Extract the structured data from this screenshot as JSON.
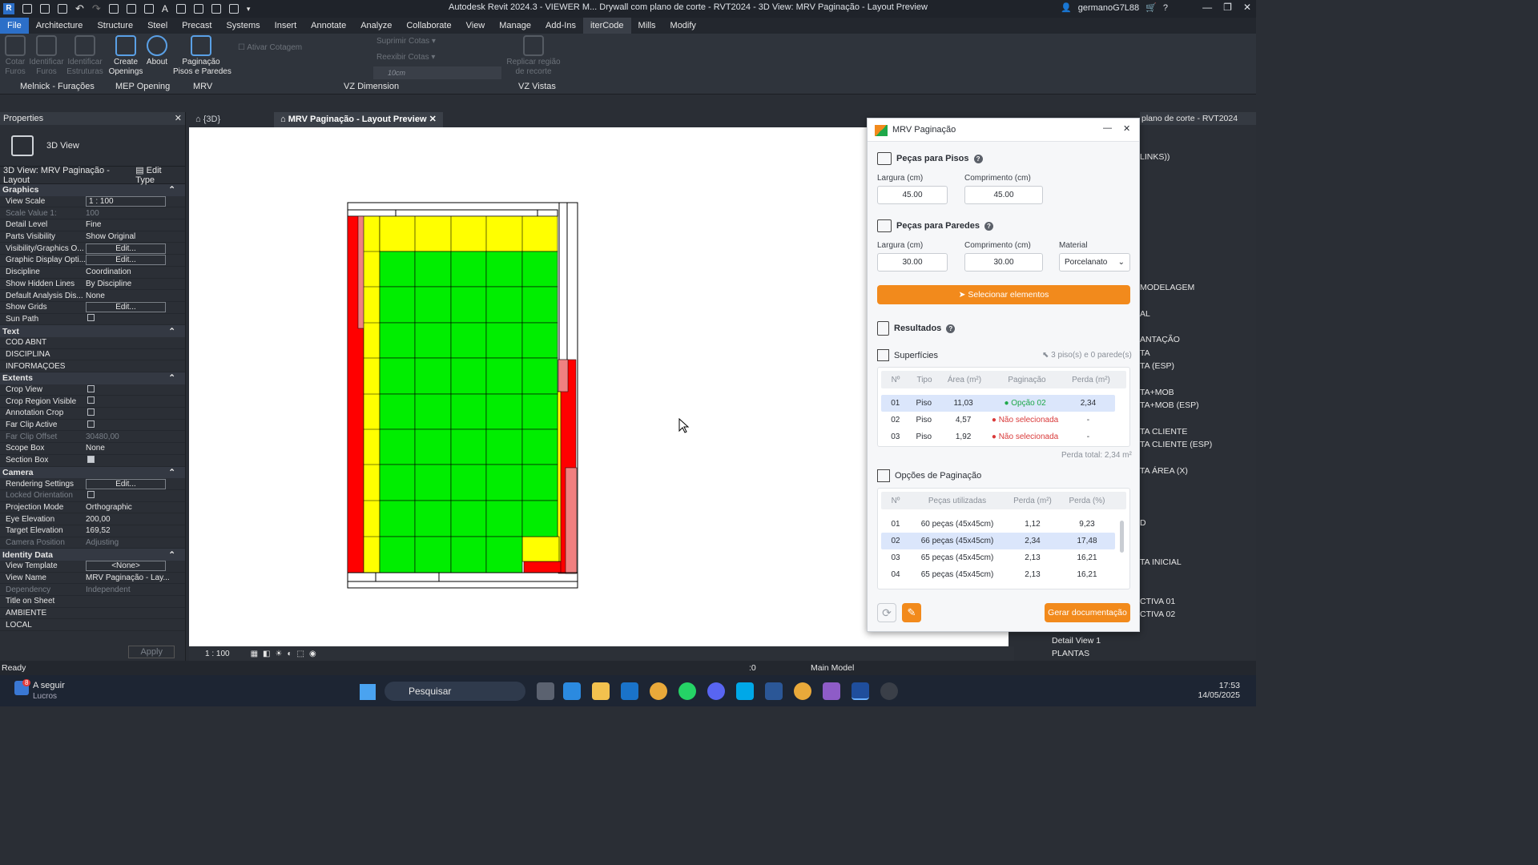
{
  "titlebar": {
    "title": "Autodesk Revit 2024.3 - VIEWER M... Drywall com plano de corte - RVT2024 - 3D View: MRV Paginação - Layout Preview",
    "user": "germanoG7L88"
  },
  "menu": [
    "File",
    "Architecture",
    "Structure",
    "Steel",
    "Precast",
    "Systems",
    "Insert",
    "Annotate",
    "Analyze",
    "Collaborate",
    "View",
    "Manage",
    "Add-Ins",
    "iterCode",
    "Mills",
    "Modify"
  ],
  "ribbon": {
    "buttons": [
      {
        "label": "Cotar\nFuros",
        "disabled": true
      },
      {
        "label": "Identificar\nFuros",
        "disabled": true
      },
      {
        "label": "Identificar\nEstruturas",
        "disabled": true
      },
      {
        "label": "Create\nOpenings",
        "disabled": false
      },
      {
        "label": "About",
        "disabled": false
      },
      {
        "label": "Paginação\nPisos e Paredes",
        "disabled": false
      }
    ],
    "vz_dim": {
      "ativar": "Ativar Cotagem",
      "suprimir": "Suprimir Cotas",
      "reexibir": "Reexibir Cotas",
      "size": "10cm"
    },
    "replicar": "Replicar região\nde recorte",
    "panels": [
      "Melnick - Furações",
      "MEP Opening",
      "MRV",
      "VZ Dimension",
      "VZ Vistas"
    ]
  },
  "properties": {
    "title": "Properties",
    "type": "3D View",
    "view_selector": "3D View: MRV Paginação - Layout",
    "edit_type": "Edit Type",
    "rows": [
      {
        "g": "Graphics"
      },
      {
        "k": "View Scale",
        "v": "1 : 100",
        "box": true
      },
      {
        "k": "Scale Value    1:",
        "v": "100",
        "dim": true
      },
      {
        "k": "Detail Level",
        "v": "Fine"
      },
      {
        "k": "Parts Visibility",
        "v": "Show Original"
      },
      {
        "k": "Visibility/Graphics O...",
        "v": "Edit...",
        "btn": true
      },
      {
        "k": "Graphic Display Opti...",
        "v": "Edit...",
        "btn": true
      },
      {
        "k": "Discipline",
        "v": "Coordination"
      },
      {
        "k": "Show Hidden Lines",
        "v": "By Discipline"
      },
      {
        "k": "Default Analysis Dis...",
        "v": "None"
      },
      {
        "k": "Show Grids",
        "v": "Edit...",
        "btn": true
      },
      {
        "k": "Sun Path",
        "chk": false
      },
      {
        "g": "Text"
      },
      {
        "k": "CÓD ABNT",
        "v": ""
      },
      {
        "k": "DISCIPLINA",
        "v": ""
      },
      {
        "k": "INFORMAÇÕES",
        "v": ""
      },
      {
        "g": "Extents"
      },
      {
        "k": "Crop View",
        "chk": false
      },
      {
        "k": "Crop Region Visible",
        "chk": false
      },
      {
        "k": "Annotation Crop",
        "chk": false
      },
      {
        "k": "Far Clip Active",
        "chk": false
      },
      {
        "k": "Far Clip Offset",
        "v": "30480,00",
        "dim": true
      },
      {
        "k": "Scope Box",
        "v": "None"
      },
      {
        "k": "Section Box",
        "chk": true
      },
      {
        "g": "Camera"
      },
      {
        "k": "Rendering Settings",
        "v": "Edit...",
        "btn": true
      },
      {
        "k": "Locked Orientation",
        "chk": false,
        "dim": true
      },
      {
        "k": "Projection Mode",
        "v": "Orthographic"
      },
      {
        "k": "Eye Elevation",
        "v": "200,00"
      },
      {
        "k": "Target Elevation",
        "v": "169,52"
      },
      {
        "k": "Camera Position",
        "v": "Adjusting",
        "dim": true
      },
      {
        "g": "Identity Data"
      },
      {
        "k": "View Template",
        "v": "<None>",
        "btn": true
      },
      {
        "k": "View Name",
        "v": "MRV Paginação - Lay..."
      },
      {
        "k": "Dependency",
        "v": "Independent",
        "dim": true
      },
      {
        "k": "Title on Sheet",
        "v": ""
      },
      {
        "k": "AMBIENTE",
        "v": ""
      },
      {
        "k": "LOCAL",
        "v": ""
      }
    ],
    "apply": "Apply"
  },
  "tabs": [
    {
      "label": "{3D}"
    },
    {
      "label": "MRV Paginação - Layout Preview"
    }
  ],
  "view_scale": "1 : 100",
  "status": {
    "left": "Ready",
    "model": "Main Model",
    "zero": ":0"
  },
  "taskbar": {
    "news_title": "A seguir",
    "news_sub": "Lucros",
    "search": "Pesquisar",
    "time": "17:53",
    "date": "14/05/2025",
    "badge": "8"
  },
  "dialog": {
    "title": "MRV Paginação",
    "pisos_title": "Peças para Pisos",
    "larg_label": "Largura (cm)",
    "comp_label": "Comprimento (cm)",
    "piso_larg": "45.00",
    "piso_comp": "45.00",
    "paredes_title": "Peças para Paredes",
    "parede_larg": "30.00",
    "parede_comp": "30.00",
    "material_label": "Material",
    "material": "Porcelanato",
    "select_btn": "Selecionar elementos",
    "resultados": "Resultados",
    "superficies": "Superfícies",
    "sel_summary": "3 piso(s) e 0 parede(s)",
    "sup_headers": [
      "Nº",
      "Tipo",
      "Área (m²)",
      "Paginação",
      "Perda (m²)"
    ],
    "sup_rows": [
      {
        "n": "01",
        "tipo": "Piso",
        "area": "11,03",
        "pag": "Opção 02",
        "ok": true,
        "perda": "2,34"
      },
      {
        "n": "02",
        "tipo": "Piso",
        "area": "4,57",
        "pag": "Não selecionada",
        "ok": false,
        "perda": "-"
      },
      {
        "n": "03",
        "tipo": "Piso",
        "area": "1,92",
        "pag": "Não selecionada",
        "ok": false,
        "perda": "-"
      }
    ],
    "perda_total": "Perda total: 2,34 m²",
    "opcoes": "Opções de Paginação",
    "opt_headers": [
      "Nº",
      "Peças utilizadas",
      "Perda (m²)",
      "Perda (%)"
    ],
    "opt_rows": [
      {
        "n": "01",
        "p": "60 peças (45x45cm)",
        "m": "1,12",
        "pc": "9,23"
      },
      {
        "n": "02",
        "p": "66 peças (45x45cm)",
        "m": "2,34",
        "pc": "17,48"
      },
      {
        "n": "03",
        "p": "65 peças (45x45cm)",
        "m": "2,13",
        "pc": "16,21"
      },
      {
        "n": "04",
        "p": "65 peças (45x45cm)",
        "m": "2,13",
        "pc": "16,21"
      }
    ],
    "gerar": "Gerar documentação"
  },
  "right_panel": {
    "title": "plano de corte - RVT2024",
    "items": [
      "LINKS))",
      "MODELAGEM",
      "AL",
      "ANTAÇÃO",
      "TA",
      "TA (ESP)",
      "TA+MOB",
      "TA+MOB (ESP)",
      "TA CLIENTE",
      "TA CLIENTE (ESP)",
      "TA ÁREA (X)",
      "D",
      "TA INICIAL",
      "CTIVA 01",
      "CTIVA 02",
      "Detail View 1",
      "PLANTAS"
    ]
  },
  "colors": {
    "accent": "#f28a1c",
    "floor_green": "#00ee00",
    "floor_yellow": "#ffff00",
    "wall_red": "#ff0000",
    "wall_pink": "#f08080"
  }
}
